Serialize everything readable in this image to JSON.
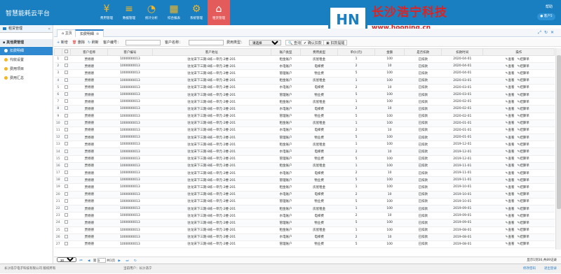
{
  "header": {
    "app_title": "智慧能耗云平台",
    "nav": [
      {
        "label": "费用管理",
        "icon": "yen-icon",
        "glyph": "¥"
      },
      {
        "label": "数据管理",
        "icon": "database-icon",
        "glyph": "≡"
      },
      {
        "label": "统计分析",
        "icon": "pie-chart-icon",
        "glyph": "◔"
      },
      {
        "label": "综合报表",
        "icon": "table-icon",
        "glyph": "▦"
      },
      {
        "label": "系统管理",
        "icon": "gear-icon",
        "glyph": "⚙"
      },
      {
        "label": "租赁管理",
        "icon": "home-icon",
        "glyph": "⌂",
        "active": true
      }
    ],
    "help": "帮助",
    "user": "客户5"
  },
  "watermark": {
    "logo_text": "HN",
    "company": "长沙浩宁科技",
    "url": "www.hooning.cn"
  },
  "sidebar": {
    "title": "租赁管理",
    "group": "其他费管理",
    "items": [
      {
        "label": "扣费明细",
        "active": true
      },
      {
        "label": "代收设置"
      },
      {
        "label": "费用项目"
      },
      {
        "label": "费用汇总"
      }
    ]
  },
  "tabs": [
    {
      "label": "主页"
    },
    {
      "label": "扣费明细",
      "active": true
    }
  ],
  "toolbar": {
    "add": "新增",
    "delete": "删除",
    "refresh": "刷新",
    "customer_no_label": "客户编号：",
    "customer_name_label": "客户名称：",
    "fee_type_label": "费用类型：",
    "fee_type_value": "请选择",
    "query": "查询",
    "confirm_deduct": "确认扣款",
    "deduct_remind": "扣款提醒"
  },
  "table": {
    "columns": [
      "客户名称",
      "客户编号",
      "客户地址",
      "账户类型",
      "费用类型",
      "单价(元)",
      "金额",
      "是否扣款",
      "扣款时间",
      "操作"
    ],
    "actions": [
      "查看",
      "结算单"
    ],
    "rows": [
      [
        "贾杨德",
        "1000000013",
        "驻龙宋下三期-8栋一单元-2楼-201",
        "租金账户",
        "房屋租金",
        "1",
        "100",
        "已扣款",
        "2020-04-01"
      ],
      [
        "贾杨德",
        "1000000013",
        "驻龙宋下三期-8栋一单元-2楼-201",
        "水电账户",
        "电梯费",
        "2",
        "10",
        "已扣款",
        "2020-04-01"
      ],
      [
        "贾杨德",
        "1000000013",
        "驻龙宋下三期-8栋一单元-2楼-201",
        "管理账户",
        "物业费",
        "5",
        "100",
        "已扣款",
        "2020-04-01"
      ],
      [
        "贾杨德",
        "1000000013",
        "驻龙宋下三期-8栋一单元-2楼-201",
        "租金账户",
        "房屋租金",
        "1",
        "100",
        "已扣款",
        "2020-03-01"
      ],
      [
        "贾杨德",
        "1000000013",
        "驻龙宋下三期-8栋一单元-2楼-201",
        "水电账户",
        "电梯费",
        "2",
        "10",
        "已扣款",
        "2020-03-01"
      ],
      [
        "贾杨德",
        "1000000013",
        "驻龙宋下三期-8栋一单元-2楼-201",
        "管理账户",
        "物业费",
        "5",
        "100",
        "已扣款",
        "2020-03-01"
      ],
      [
        "贾杨德",
        "1000000013",
        "驻龙宋下三期-8栋一单元-2楼-201",
        "租金账户",
        "房屋租金",
        "1",
        "100",
        "已扣款",
        "2020-02-01"
      ],
      [
        "贾杨德",
        "1000000013",
        "驻龙宋下三期-8栋一单元-2楼-201",
        "水电账户",
        "电梯费",
        "2",
        "10",
        "已扣款",
        "2020-02-01"
      ],
      [
        "贾杨德",
        "1000000013",
        "驻龙宋下三期-8栋一单元-2楼-201",
        "管理账户",
        "物业费",
        "5",
        "100",
        "已扣款",
        "2020-02-01"
      ],
      [
        "贾杨德",
        "1000000013",
        "驻龙宋下三期-8栋一单元-2楼-201",
        "租金账户",
        "房屋租金",
        "1",
        "100",
        "已扣款",
        "2020-01-01"
      ],
      [
        "贾杨德",
        "1000000013",
        "驻龙宋下三期-8栋一单元-2楼-201",
        "水电账户",
        "电梯费",
        "2",
        "10",
        "已扣款",
        "2020-01-01"
      ],
      [
        "贾杨德",
        "1000000013",
        "驻龙宋下三期-8栋一单元-2楼-201",
        "管理账户",
        "物业费",
        "5",
        "100",
        "已扣款",
        "2020-01-01"
      ],
      [
        "贾杨德",
        "1000000013",
        "驻龙宋下三期-8栋一单元-2楼-201",
        "租金账户",
        "房屋租金",
        "1",
        "100",
        "已扣款",
        "2019-12-01"
      ],
      [
        "贾杨德",
        "1000000013",
        "驻龙宋下三期-8栋一单元-2楼-201",
        "水电账户",
        "电梯费",
        "2",
        "10",
        "已扣款",
        "2019-12-01"
      ],
      [
        "贾杨德",
        "1000000013",
        "驻龙宋下三期-8栋一单元-2楼-201",
        "管理账户",
        "物业费",
        "5",
        "100",
        "已扣款",
        "2019-12-01"
      ],
      [
        "贾杨德",
        "1000000013",
        "驻龙宋下三期-8栋一单元-2楼-201",
        "租金账户",
        "房屋租金",
        "1",
        "100",
        "已扣款",
        "2019-11-01"
      ],
      [
        "贾杨德",
        "1000000013",
        "驻龙宋下三期-8栋一单元-2楼-201",
        "水电账户",
        "电梯费",
        "2",
        "10",
        "已扣款",
        "2019-11-01"
      ],
      [
        "贾杨德",
        "1000000013",
        "驻龙宋下三期-8栋一单元-2楼-201",
        "管理账户",
        "物业费",
        "5",
        "100",
        "已扣款",
        "2019-11-01"
      ],
      [
        "贾杨德",
        "1000000013",
        "驻龙宋下三期-8栋一单元-2楼-201",
        "租金账户",
        "房屋租金",
        "1",
        "100",
        "已扣款",
        "2019-10-01"
      ],
      [
        "贾杨德",
        "1000000013",
        "驻龙宋下三期-8栋一单元-2楼-201",
        "水电账户",
        "电梯费",
        "2",
        "10",
        "已扣款",
        "2019-10-01"
      ],
      [
        "贾杨德",
        "1000000013",
        "驻龙宋下三期-8栋一单元-2楼-201",
        "管理账户",
        "物业费",
        "5",
        "100",
        "已扣款",
        "2019-10-01"
      ],
      [
        "贾杨德",
        "1000000013",
        "驻龙宋下三期-8栋一单元-2楼-201",
        "租金账户",
        "房屋租金",
        "1",
        "100",
        "已扣款",
        "2019-09-01"
      ],
      [
        "贾杨德",
        "1000000013",
        "驻龙宋下三期-8栋一单元-2楼-201",
        "水电账户",
        "电梯费",
        "2",
        "10",
        "已扣款",
        "2019-09-01"
      ],
      [
        "贾杨德",
        "1000000013",
        "驻龙宋下三期-8栋一单元-2楼-201",
        "管理账户",
        "物业费",
        "5",
        "100",
        "已扣款",
        "2019-09-01"
      ],
      [
        "贾杨德",
        "1000000013",
        "驻龙宋下三期-8栋一单元-2楼-201",
        "租金账户",
        "房屋租金",
        "1",
        "100",
        "已扣款",
        "2019-08-01"
      ],
      [
        "贾杨德",
        "1000000013",
        "驻龙宋下三期-8栋一单元-2楼-201",
        "水电账户",
        "电梯费",
        "2",
        "10",
        "已扣款",
        "2019-08-01"
      ],
      [
        "贾杨德",
        "1000000013",
        "驻龙宋下三期-8栋一单元-2楼-201",
        "管理账户",
        "物业费",
        "5",
        "100",
        "已扣款",
        "2019-08-01"
      ]
    ]
  },
  "pager": {
    "page_size": "30",
    "page_label": "第",
    "page": "1",
    "total_pages": "共1页",
    "summary": "显示1到30,共89记录"
  },
  "footer": {
    "company": "长沙浩宁电子科技有限公司 版权所有",
    "login_user": "当前用户：长沙浩宁",
    "change_password": "修改密码",
    "logout": "退出登录"
  }
}
